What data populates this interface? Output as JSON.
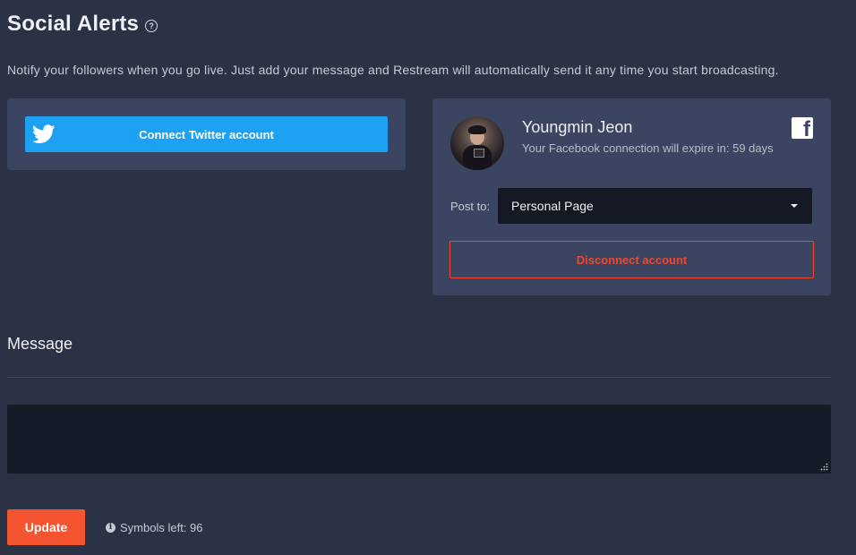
{
  "header": {
    "title": "Social Alerts",
    "help_icon": "question-circle-icon",
    "description": "Notify your followers when you go live. Just add your message and Restream will automatically send it any time you start broadcasting."
  },
  "twitter": {
    "icon": "twitter-bird-icon",
    "button_label": "Connect Twitter account",
    "color": "#1da1f2"
  },
  "facebook": {
    "icon": "facebook-icon",
    "name": "Youngmin Jeon",
    "expire_text": "Your Facebook connection will expire in: 59 days",
    "post_to_label": "Post to:",
    "post_to_value": "Personal Page",
    "disconnect_label": "Disconnect account",
    "disconnect_color": "#f0472e"
  },
  "message": {
    "section_title": "Message",
    "value": "",
    "update_label": "Update",
    "update_color": "#f4542f",
    "symbols_left": "Symbols left: 96",
    "info_icon": "info-circle-icon"
  }
}
